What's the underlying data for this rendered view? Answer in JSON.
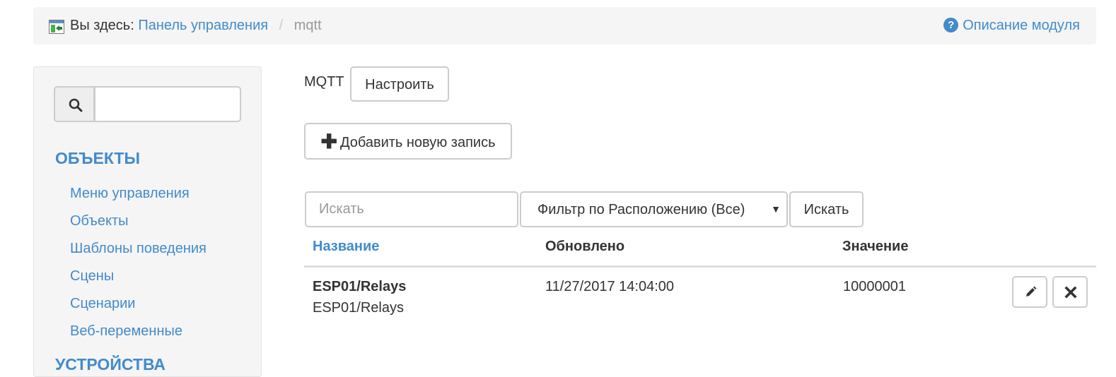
{
  "breadcrumb": {
    "prefix": "Вы здесь:",
    "home": "Панель управления",
    "separator": "/",
    "current": "mqtt",
    "help_icon": "?",
    "help_label": "Описание модуля"
  },
  "sidebar": {
    "search": {
      "value": "",
      "placeholder": ""
    },
    "sections": [
      {
        "heading": "ОБЪЕКТЫ",
        "items": [
          {
            "label": "Меню управления"
          },
          {
            "label": "Объекты"
          },
          {
            "label": "Шаблоны поведения"
          },
          {
            "label": "Сцены"
          },
          {
            "label": "Сценарии"
          },
          {
            "label": "Веб-переменные"
          }
        ]
      },
      {
        "heading": "УСТРОЙСТВА"
      }
    ]
  },
  "main": {
    "module_label": "MQTT",
    "configure_label": "Настроить",
    "add_icon": "✚",
    "add_label": "Добавить новую запись",
    "filter": {
      "search_placeholder": "Искать",
      "search_value": "",
      "location_selected": "Фильтр по Расположению (Все)",
      "dropdown_arrow": "▼",
      "search_button": "Искать"
    },
    "table": {
      "columns": [
        "Название",
        "Обновлено",
        "Значение"
      ],
      "rows": [
        {
          "title": "ESP01/Relays",
          "path": "ESP01/Relays",
          "updated": "11/27/2017 14:04:00",
          "value": "10000001"
        }
      ]
    }
  },
  "colors": {
    "link": "#428bca",
    "panel_bg": "#f5f5f5",
    "border": "#cccccc",
    "text": "#333333"
  },
  "icons": {
    "breadcrumb": "home-panel-icon",
    "help": "question-circle-icon",
    "search": "search-icon",
    "add": "plus-icon",
    "edit": "pencil-icon",
    "delete": "close-icon",
    "dropdown": "chevron-down-icon"
  }
}
